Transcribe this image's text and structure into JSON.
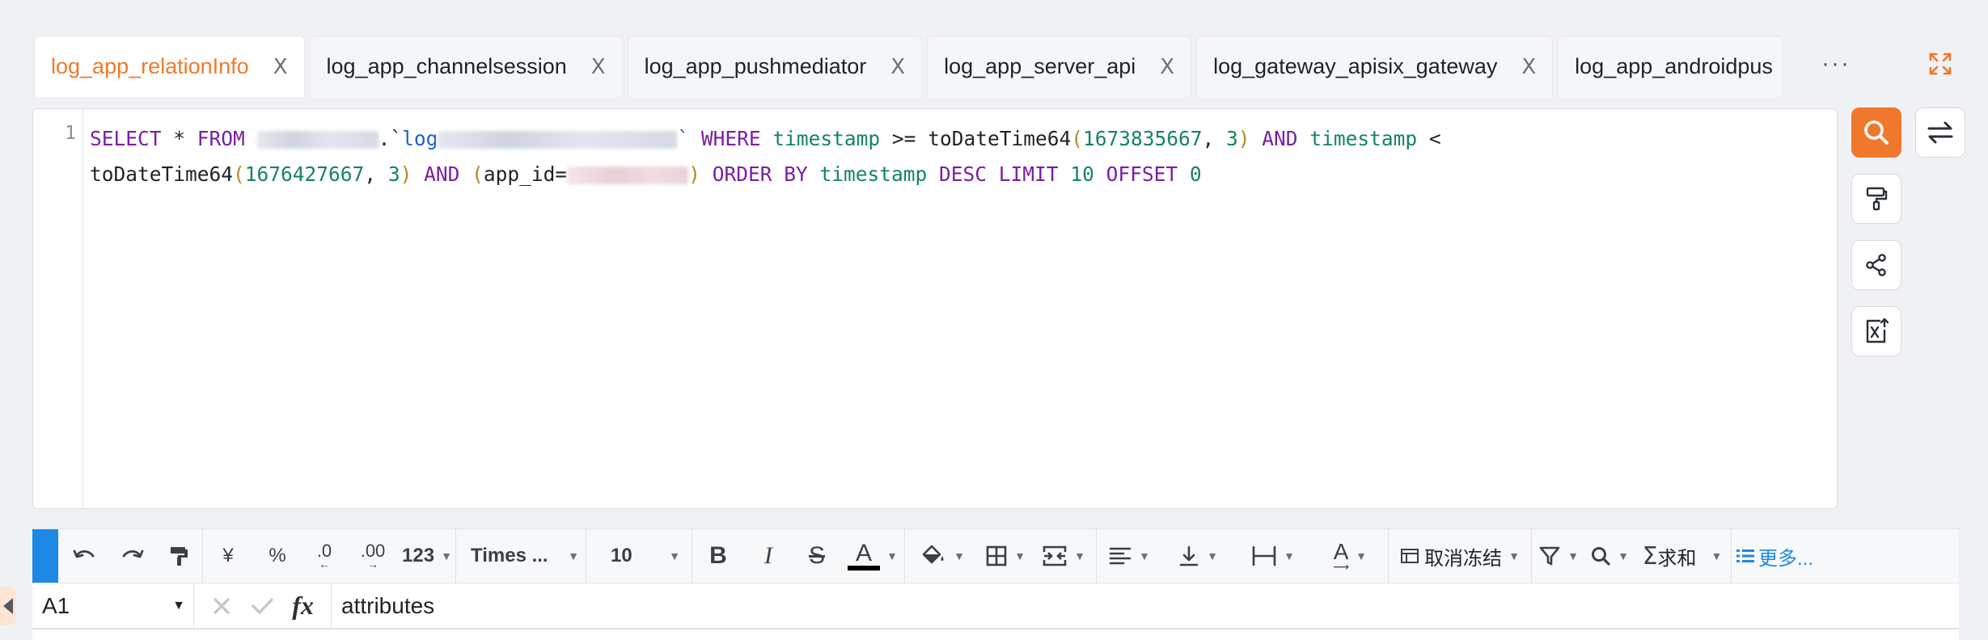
{
  "tabs": [
    {
      "label": "log_app_relationInfo",
      "close": "X",
      "active": true
    },
    {
      "label": "log_app_channelsession",
      "close": "X"
    },
    {
      "label": "log_app_pushmediator",
      "close": "X"
    },
    {
      "label": "log_app_server_api",
      "close": "X"
    },
    {
      "label": "log_gateway_apisix_gateway",
      "close": "X"
    },
    {
      "label": "log_app_androidpus"
    }
  ],
  "tab_more": "···",
  "editor": {
    "line_number": "1",
    "tokens": {
      "select": "SELECT",
      "star": " * ",
      "from": "FROM",
      "dot_tick": ".`",
      "log": "log",
      "tick_end": "`",
      "where": "WHERE",
      "timestamp": "timestamp",
      "gte": " >= ",
      "todatetime": "toDateTime64",
      "open": "(",
      "ts1": "1673835667",
      "comma": ", ",
      "three": "3",
      "close": ")",
      "and": "AND",
      "lt": " <",
      "ts2": "1676427667",
      "app_id": "app_id=",
      "order_by": "ORDER BY",
      "desc": "DESC",
      "limit": "LIMIT",
      "ten": "10",
      "offset": "OFFSET",
      "zero": "0"
    }
  },
  "actions": {
    "search": "search-icon",
    "switch": "swap-icon",
    "format": "format-brush-icon",
    "share": "share-icon",
    "export": "export-excel-icon"
  },
  "toolbar": {
    "currency": "¥",
    "percent": "%",
    "decimal_decrease": ".0",
    "decimal_increase": ".00",
    "number_format": "123",
    "font_family": "Times ...",
    "font_size": "10",
    "bold": "B",
    "italic": "I",
    "strike": "S",
    "font_color": "A",
    "text_rotate": "A",
    "freeze": "取消冻结",
    "sum": "求和",
    "more": "更多..."
  },
  "formula": {
    "cell_ref": "A1",
    "fx": "fx",
    "value": "attributes"
  },
  "colors": {
    "accent": "#f0782c",
    "active_tab": "#f07a2b",
    "toolbar_accent": "#1e88e5",
    "link_blue": "#1e88e5"
  }
}
